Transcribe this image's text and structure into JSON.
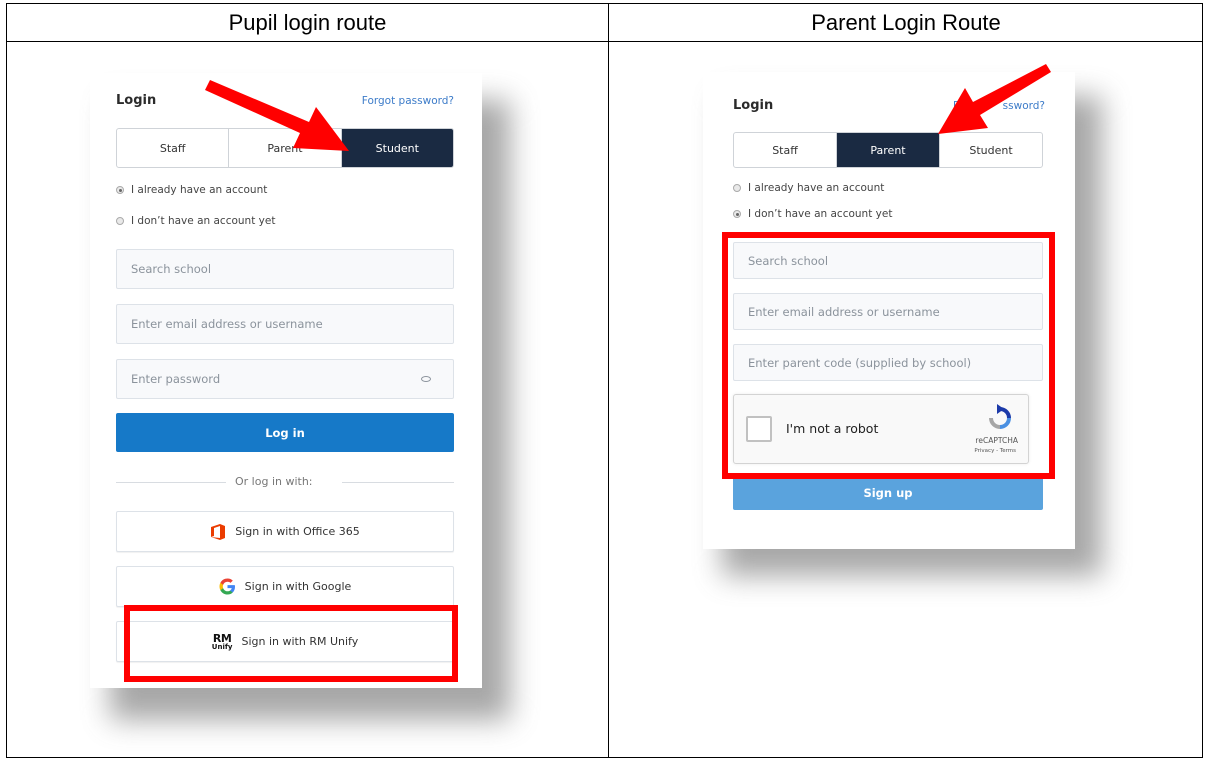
{
  "columns": {
    "left_title": "Pupil login route",
    "right_title": "Parent Login Route"
  },
  "pupil": {
    "title": "Login",
    "forgot": "Forgot password?",
    "tabs": [
      "Staff",
      "Parent",
      "Student"
    ],
    "active_tab": "Student",
    "radio_have": "I already have an account",
    "radio_dont": "I don’t have an account yet",
    "selected_radio": "I already have an account",
    "search_placeholder": "Search school",
    "email_placeholder": "Enter email address or username",
    "password_placeholder": "Enter password",
    "login_button": "Log in",
    "divider": "Or log in with:",
    "office": "Sign in with Office 365",
    "google": "Sign in with Google",
    "rm": "Sign in with RM Unify",
    "rm_logo_top": "RM",
    "rm_logo_bottom": "Unify"
  },
  "parent": {
    "title": "Login",
    "forgot_partial": "F",
    "forgot_suffix": "ssword?",
    "tabs": [
      "Staff",
      "Parent",
      "Student"
    ],
    "active_tab": "Parent",
    "radio_have": "I already have an account",
    "radio_dont": "I don’t have an account yet",
    "selected_radio": "I don’t have an account yet",
    "search_placeholder": "Search school",
    "email_placeholder": "Enter email address or username",
    "code_placeholder": "Enter parent code (supplied by school)",
    "captcha_label": "I'm not a robot",
    "captcha_brand": "reCAPTCHA",
    "captcha_terms": "Privacy - Terms",
    "signup_button": "Sign up"
  },
  "colors": {
    "annotation_red": "#ff0000",
    "active_tab": "#1a2a42",
    "primary": "#1679c8",
    "link": "#3d7cc9"
  }
}
